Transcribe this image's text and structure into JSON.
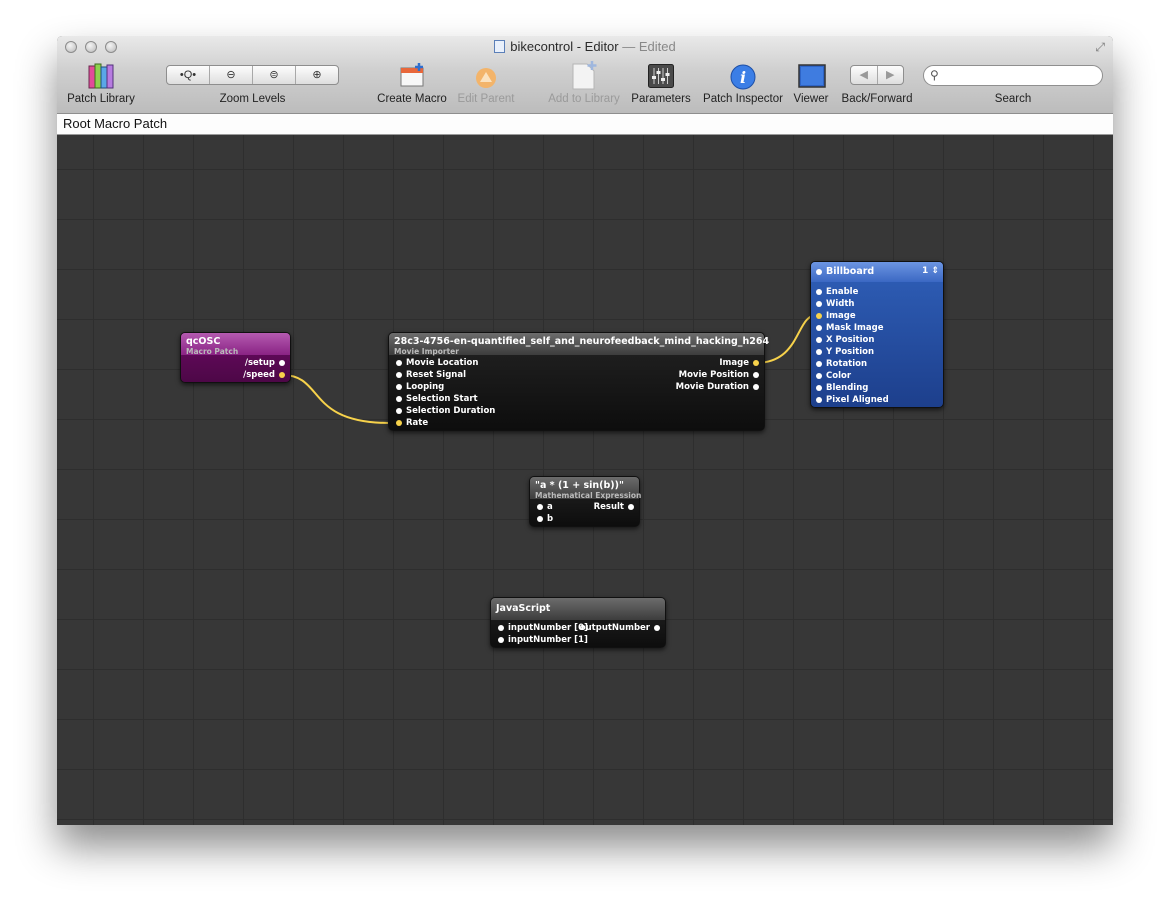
{
  "window": {
    "title": "bikecontrol - Editor",
    "title_separator": "—",
    "edited": "Edited"
  },
  "toolbar": {
    "patch_library": "Patch Library",
    "zoom_levels": "Zoom Levels",
    "create_macro": "Create Macro",
    "edit_parent": "Edit Parent",
    "add_to_library": "Add to Library",
    "parameters": "Parameters",
    "patch_inspector": "Patch Inspector",
    "viewer": "Viewer",
    "back_forward": "Back/Forward",
    "search_label": "Search",
    "search_value": ""
  },
  "pathbar": {
    "label": "Root Macro Patch"
  },
  "nodes": {
    "qcosc": {
      "title": "qcOSC",
      "subtitle": "Macro Patch",
      "outputs": [
        "/setup",
        "/speed"
      ]
    },
    "movie": {
      "title": "28c3-4756-en-quantified_self_and_neurofeedback_mind_hacking_h264",
      "subtitle": "Movie Importer",
      "inputs": [
        "Movie Location",
        "Reset Signal",
        "Looping",
        "Selection Start",
        "Selection Duration",
        "Rate"
      ],
      "outputs": [
        "Image",
        "Movie Position",
        "Movie Duration"
      ]
    },
    "billboard": {
      "title": "Billboard",
      "layer": "1",
      "inputs": [
        "Enable",
        "Width",
        "Image",
        "Mask Image",
        "X Position",
        "Y Position",
        "Rotation",
        "Color",
        "Blending",
        "Pixel Aligned"
      ]
    },
    "math": {
      "title": "\"a * (1 + sin(b))\"",
      "subtitle": "Mathematical Expression",
      "inputs": [
        "a",
        "b"
      ],
      "outputs": [
        "Result"
      ]
    },
    "js": {
      "title": "JavaScript",
      "inputs": [
        "inputNumber [0]",
        "inputNumber [1]"
      ],
      "outputs": [
        "outputNumber"
      ]
    }
  },
  "colors": {
    "connection": "#f7d24b",
    "macro_patch": "#6a0a62",
    "renderer_patch": "#2f5fb8",
    "processor_patch": "#232323",
    "canvas": "#373737"
  },
  "icons": [
    "patch-library-icon",
    "zoom-icons",
    "create-macro-icon",
    "edit-parent-icon",
    "add-to-library-icon",
    "parameters-icon",
    "patch-inspector-icon",
    "viewer-icon",
    "back-forward-icons",
    "search-icon"
  ]
}
